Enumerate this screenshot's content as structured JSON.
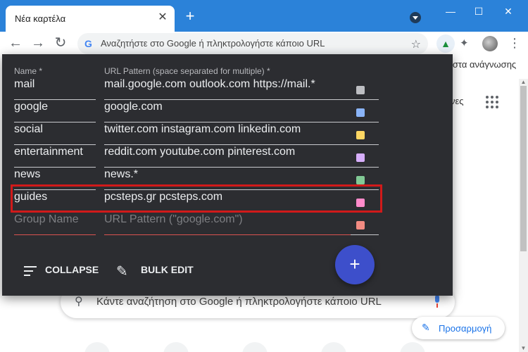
{
  "browser": {
    "tab_title": "Νέα καρτέλα",
    "omnibox_placeholder": "Αναζητήστε στο Google ή πληκτρολογήστε κάποιο URL",
    "bookmarks_partial": "ίστα ανάγνωσης",
    "partial_word": "νες",
    "icons": [
      "close-icon",
      "plus-icon",
      "back-icon",
      "forward-icon",
      "reload-icon",
      "google-icon",
      "star-icon",
      "extension-icon",
      "puzzle-icon",
      "avatar",
      "more-icon",
      "minimize-icon",
      "maximize-icon"
    ]
  },
  "popup": {
    "header_name": "Name *",
    "header_url": "URL Pattern (space separated for multiple) *",
    "rows": [
      {
        "name": "mail",
        "pattern": "mail.google.com outlook.com https://mail.*",
        "color": "#bdbec2"
      },
      {
        "name": "google",
        "pattern": "google.com",
        "color": "#8ab4f8"
      },
      {
        "name": "social",
        "pattern": "twitter.com instagram.com linkedin.com",
        "color": "#fdd663"
      },
      {
        "name": "entertainment",
        "pattern": "reddit.com youtube.com pinterest.com",
        "color": "#d7aefb"
      },
      {
        "name": "news",
        "pattern": "news.*",
        "color": "#81c995"
      },
      {
        "name": "guides",
        "pattern": "pcsteps.gr pcsteps.com",
        "color": "#ff8bcb"
      }
    ],
    "new_row": {
      "name_placeholder": "Group Name",
      "pattern_placeholder": "URL Pattern (\"google.com\")",
      "color": "#f28b82"
    },
    "collapse_label": "COLLAPSE",
    "bulk_edit_label": "BULK EDIT",
    "fab_label": "+",
    "highlight_color": "#d11a1a"
  },
  "newtab": {
    "search_placeholder": "Κάντε αναζήτηση στο Google ή πληκτρολογήστε κάποιο URL",
    "customize_label": "Προσαρμογή"
  }
}
